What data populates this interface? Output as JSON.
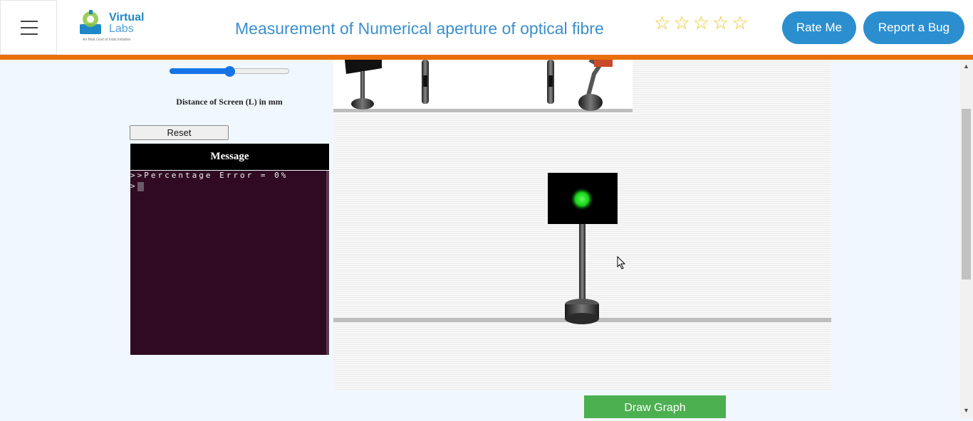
{
  "header": {
    "logo": {
      "line1": "Virtual",
      "line2": "Labs",
      "tagline": "An MoE Govt of India Initiative"
    },
    "title": "Measurement of Numerical aperture of optical fibre",
    "rating": {
      "stars": 5,
      "filled": 0,
      "icon": "star-outline-icon"
    },
    "rate_label": "Rate Me",
    "bug_label": "Report a Bug"
  },
  "controls": {
    "slider_value_fraction": 0.5,
    "distance_label": "Distance of Screen (L) in mm",
    "reset_label": "Reset"
  },
  "message": {
    "title": "Message",
    "lines": [
      ">>Percentage Error = 0%",
      ">"
    ]
  },
  "simulation": {
    "spot_color": "#22dd22"
  },
  "actions": {
    "draw_graph_label": "Draw Graph"
  },
  "colors": {
    "accent_blue": "#2b8fcf",
    "header_bar": "#e8700c",
    "console_bg": "#2f0a22",
    "button_green": "#4caf50"
  }
}
